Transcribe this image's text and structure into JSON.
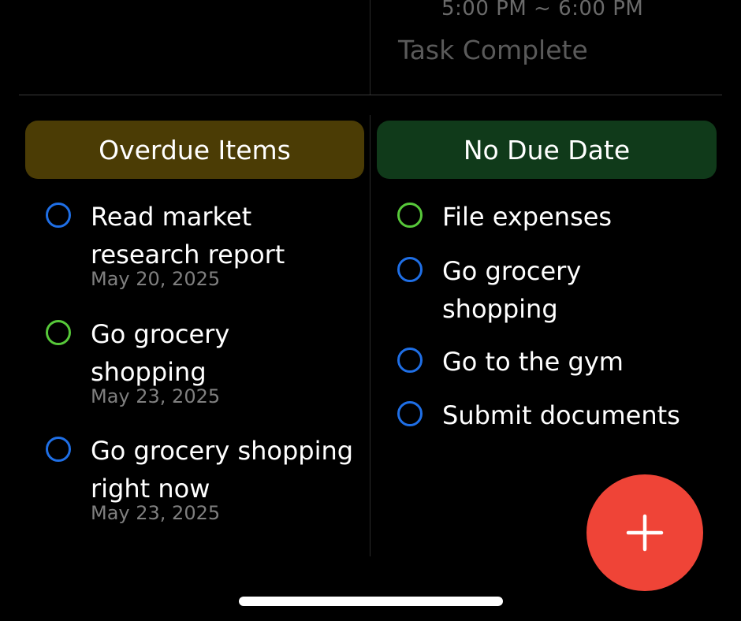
{
  "top": {
    "time_range": "5:00 PM ~ 6:00 PM",
    "status": "Task Complete"
  },
  "colors": {
    "background": "#000000",
    "overdue_header": "#4b3c05",
    "no_due_header": "#103a1a",
    "circle_blue": "#1f6fe6",
    "circle_green": "#57c83a",
    "fab": "#ef4437"
  },
  "overdue": {
    "header": "Overdue Items",
    "items": [
      {
        "title": "Read market research report",
        "date": "May 20, 2025",
        "circle": "blue"
      },
      {
        "title": "Go grocery shopping",
        "date": "May 23, 2025",
        "circle": "green"
      },
      {
        "title": "Go grocery shopping right now",
        "date": "May 23, 2025",
        "circle": "blue"
      }
    ]
  },
  "no_due": {
    "header": "No Due Date",
    "items": [
      {
        "title": "File expenses",
        "circle": "green"
      },
      {
        "title": "Go grocery shopping",
        "circle": "blue"
      },
      {
        "title": "Go to the gym",
        "circle": "blue"
      },
      {
        "title": "Submit documents",
        "circle": "blue"
      }
    ]
  },
  "fab": {
    "icon": "plus-icon"
  }
}
